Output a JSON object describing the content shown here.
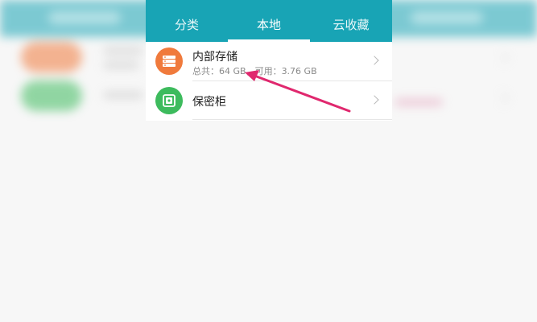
{
  "tabs": [
    {
      "label": "分类"
    },
    {
      "label": "本地"
    },
    {
      "label": "云收藏"
    }
  ],
  "active_tab": "本地",
  "items": [
    {
      "title": "内部存储",
      "subtitle": "总共：64 GB，可用：3.76 GB",
      "icon": "storage-icon",
      "icon_color": "#f07a3c"
    },
    {
      "title": "保密柜",
      "icon": "safe-icon",
      "icon_color": "#3dbb5d"
    }
  ],
  "colors": {
    "header": "#18a4b5",
    "annotation_arrow": "#e0286e"
  }
}
